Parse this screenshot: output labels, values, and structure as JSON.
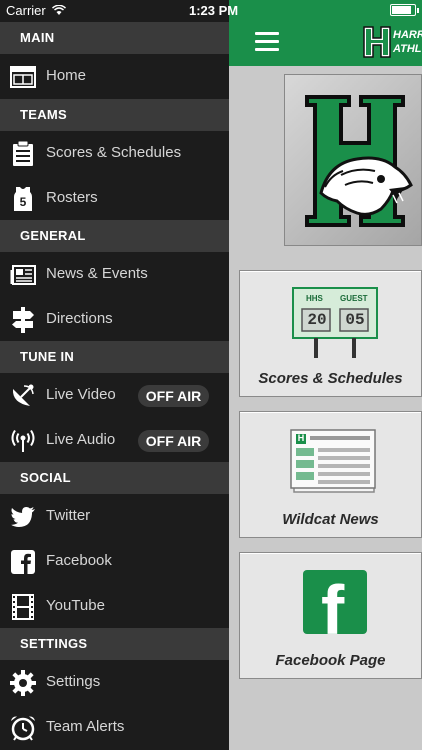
{
  "status_bar": {
    "carrier": "Carrier",
    "time": "1:23 PM",
    "battery_level": 0.9
  },
  "sidebar": {
    "sections": [
      {
        "title": "MAIN",
        "items": [
          {
            "label": "Home",
            "icon": "home-icon"
          }
        ]
      },
      {
        "title": "TEAMS",
        "items": [
          {
            "label": "Scores & Schedules",
            "icon": "scoreboard-icon"
          },
          {
            "label": "Rosters",
            "icon": "jersey-icon",
            "icon_text": "5"
          }
        ]
      },
      {
        "title": "GENERAL",
        "items": [
          {
            "label": "News & Events",
            "icon": "newspaper-icon"
          },
          {
            "label": "Directions",
            "icon": "signpost-icon"
          }
        ]
      },
      {
        "title": "TUNE IN",
        "items": [
          {
            "label": "Live Video",
            "icon": "satellite-dish-icon",
            "badge": "OFF AIR"
          },
          {
            "label": "Live Audio",
            "icon": "broadcast-icon",
            "badge": "OFF AIR"
          }
        ]
      },
      {
        "title": "SOCIAL",
        "items": [
          {
            "label": "Twitter",
            "icon": "twitter-icon"
          },
          {
            "label": "Facebook",
            "icon": "facebook-icon"
          },
          {
            "label": "YouTube",
            "icon": "film-strip-icon"
          }
        ]
      },
      {
        "title": "SETTINGS",
        "items": [
          {
            "label": "Settings",
            "icon": "gear-icon"
          },
          {
            "label": "Team Alerts",
            "icon": "alarm-clock-icon"
          }
        ]
      }
    ]
  },
  "header": {
    "brand_line1": "HARR",
    "brand_line2": "ATHL",
    "logo_letter": "H"
  },
  "main": {
    "logo_letter": "H",
    "cards": [
      {
        "caption": "Scores & Schedules",
        "home_label": "HHS",
        "guest_label": "GUEST",
        "home_score": "20",
        "guest_score": "05"
      },
      {
        "caption": "Wildcat News",
        "paper_letter": "H"
      },
      {
        "caption": "Facebook Page",
        "icon_letter": "f"
      }
    ]
  },
  "colors": {
    "brand_green": "#1a8f4a",
    "sidebar_bg": "#1c1c1c",
    "section_bg": "#3a3a3a",
    "main_bg": "#c9c9c9"
  }
}
